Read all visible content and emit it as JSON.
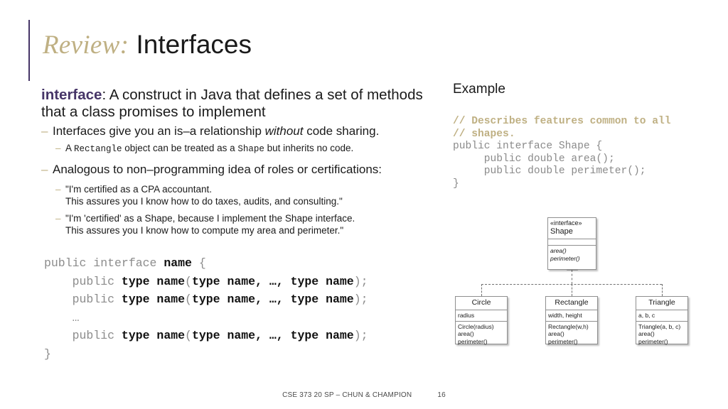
{
  "title": {
    "prefix": "Review:",
    "main": " Interfaces",
    "accent_color": "#463567",
    "prefix_color": "#bfb083"
  },
  "left": {
    "definition_keyword": "interface",
    "definition_rest": ": A construct in Java that defines a set of methods that a class promises to implement",
    "bullets": [
      {
        "dash": "–",
        "pre": "Interfaces give you an is–a relationship ",
        "italic": "without",
        "post": " code sharing."
      },
      {
        "dash": "–",
        "pre": "Analogous to non–programming idea of roles or certifications:",
        "italic": "",
        "post": ""
      }
    ],
    "sub_rectangle": {
      "dash": "–",
      "a": "A ",
      "mono1": "Rectangle",
      "b": " object can be treated as a ",
      "mono2": "Shape",
      "c": " but inherits no code."
    },
    "quotes": [
      {
        "dash": "–",
        "line1": "\"I'm certified as a CPA accountant.",
        "line2": "This assures you I know how to do taxes, audits, and consulting.\""
      },
      {
        "dash": "–",
        "line1": "\"I'm 'certified' as a Shape, because I implement the Shape interface.",
        "line2": "This assures you I know how to compute my area and perimeter.\""
      }
    ],
    "code_template": {
      "line1_a": "public interface ",
      "line1_b": "name",
      "line1_c": " {",
      "line2_a": "    public ",
      "line2_b": "type name",
      "line2_c": "(",
      "line2_d": "type name",
      "line2_e": ", …, ",
      "line2_f": "type name",
      "line2_g": ");",
      "line_ellipsis": "    …",
      "line_close": "}"
    }
  },
  "right": {
    "heading": "Example",
    "code": {
      "comment1": "// Describes features common to all",
      "comment2": "// shapes.",
      "l1": "public interface Shape {",
      "l2": "     public double area();",
      "l3": "     public double perimeter();",
      "l4": "}"
    }
  },
  "uml": {
    "interface_box": {
      "stereotype": "«interface»",
      "name": "Shape",
      "attributes": [],
      "methods": [
        "area()",
        "perimeter()"
      ]
    },
    "classes": [
      {
        "name": "Circle",
        "attributes": [
          "radius"
        ],
        "methods": [
          "Circle(radius)",
          "area()",
          "perimeter()"
        ]
      },
      {
        "name": "Rectangle",
        "attributes": [
          "width, height"
        ],
        "methods": [
          "Rectangle(w,h)",
          "area()",
          "perimeter()"
        ]
      },
      {
        "name": "Triangle",
        "attributes": [
          "a, b, c"
        ],
        "methods": [
          "Triangle(a, b, c)",
          "area()",
          "perimeter()"
        ]
      }
    ]
  },
  "footer": {
    "text": "CSE 373 20 SP – CHUN & CHAMPION",
    "page": "16"
  }
}
